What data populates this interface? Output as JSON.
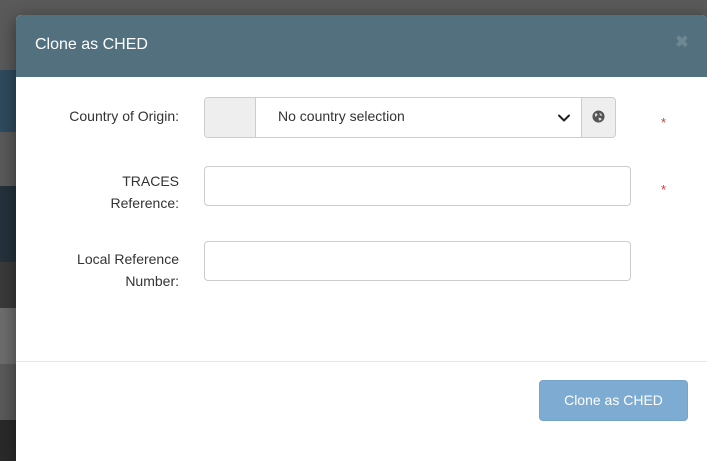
{
  "modal": {
    "title": "Clone as CHED",
    "close_symbol": "✖"
  },
  "form": {
    "country_label": "Country of Origin:",
    "country_value": "No country selection",
    "traces_label_line1": "TRACES",
    "traces_label_line2": "Reference:",
    "traces_value": "",
    "local_label_line1": "Local Reference",
    "local_label_line2": "Number:",
    "local_value": "",
    "required_mark": "*"
  },
  "footer": {
    "submit_label": "Clone as CHED"
  },
  "colors": {
    "header": "#53707f",
    "primary_button": "#7eabd1",
    "required": "#e0353a"
  },
  "icons": {
    "close": "close-icon",
    "select": "chevron-down-icon",
    "globe": "globe-icon"
  }
}
